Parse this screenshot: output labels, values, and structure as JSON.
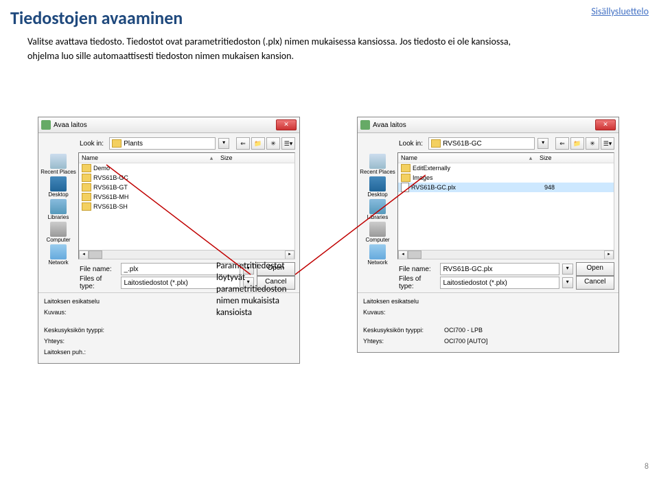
{
  "page": {
    "title": "Tiedostojen avaaminen",
    "toc_link": "Sisällysluettelo",
    "body_text": "Valitse avattava tiedosto. Tiedostot ovat parametritiedoston (.plx) nimen mukaisessa kansiossa. Jos tiedosto ei ole kansiossa, ohjelma luo sille automaattisesti tiedoston nimen mukaisen kansion.",
    "page_number": "8"
  },
  "callout": {
    "text": "Parametritiedostot löytyvät parametritiedoston nimen mukaisista kansioista"
  },
  "common": {
    "dialog_title": "Avaa laitos",
    "lookin_label": "Look in:",
    "col_name": "Name",
    "col_size": "Size",
    "file_name_label": "File name:",
    "files_of_type_label": "Files of type:",
    "files_of_type_value": "Laitostiedostot (*.plx)",
    "open_btn": "Open",
    "cancel_btn": "Cancel",
    "preview_heading": "Laitoksen esikatselu",
    "kuvaus_label": "Kuvaus:",
    "keskus_label": "Keskusyksikön tyyppi:",
    "yhteys_label": "Yhteys:",
    "puh_label": "Laitoksen puh.:",
    "places": {
      "recent": "Recent Places",
      "desktop": "Desktop",
      "libraries": "Libraries",
      "computer": "Computer",
      "network": "Network"
    }
  },
  "left_dialog": {
    "lookin_value": "Plants",
    "file_name_value": "_.plx",
    "files": [
      {
        "name": "Demo",
        "type": "folder"
      },
      {
        "name": "RVS61B-GC",
        "type": "folder"
      },
      {
        "name": "RVS61B-GT",
        "type": "folder"
      },
      {
        "name": "RVS61B-MH",
        "type": "folder"
      },
      {
        "name": "RVS61B-SH",
        "type": "folder"
      }
    ],
    "keskus_value": "",
    "yhteys_value": "",
    "puh_value": ""
  },
  "right_dialog": {
    "lookin_value": "RVS61B-GC",
    "file_name_value": "RVS61B-GC.plx",
    "files": [
      {
        "name": "EditExternally",
        "type": "folder"
      },
      {
        "name": "Images",
        "type": "folder"
      },
      {
        "name": "RVS61B-GC.plx",
        "type": "file",
        "size": "948",
        "selected": true
      }
    ],
    "keskus_value": "OCI700 - LPB",
    "yhteys_value": "OCI700 [AUTO]"
  }
}
